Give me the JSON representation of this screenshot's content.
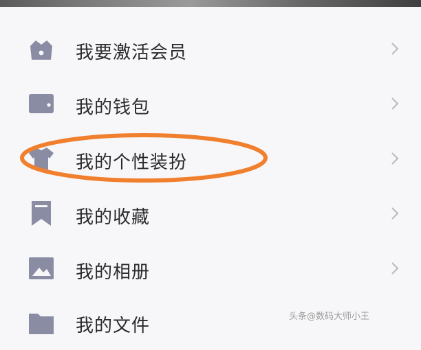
{
  "menu": {
    "items": [
      {
        "label": "我要激活会员",
        "icon": "crown-icon"
      },
      {
        "label": "我的钱包",
        "icon": "wallet-icon"
      },
      {
        "label": "我的个性装扮",
        "icon": "shirt-icon"
      },
      {
        "label": "我的收藏",
        "icon": "bookmark-icon"
      },
      {
        "label": "我的相册",
        "icon": "photo-icon"
      },
      {
        "label": "我的文件",
        "icon": "folder-icon"
      }
    ]
  },
  "colors": {
    "icon": "#8a8ca4",
    "highlight": "#f07f2e",
    "background": "#f7f7f9",
    "chevron": "#b8b8c0"
  },
  "watermark": "头条@数码大师小王"
}
